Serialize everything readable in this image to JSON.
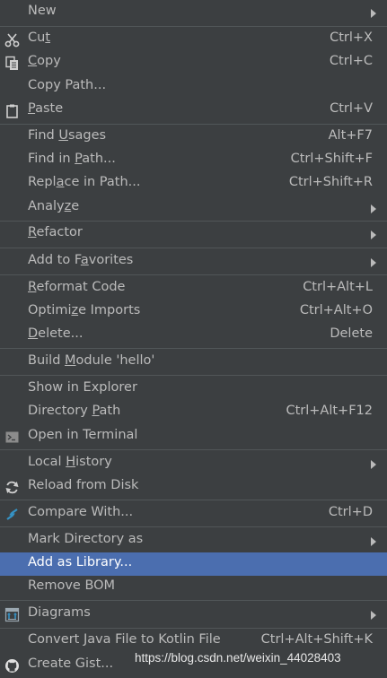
{
  "menu": {
    "items": [
      {
        "pre": "New",
        "u": "",
        "post": "",
        "shortcut": ""
      },
      {
        "pre": "Cu",
        "u": "t",
        "post": "",
        "shortcut": "Ctrl+X"
      },
      {
        "pre": "",
        "u": "C",
        "post": "opy",
        "shortcut": "Ctrl+C"
      },
      {
        "pre": "Copy Path...",
        "u": "",
        "post": "",
        "shortcut": ""
      },
      {
        "pre": "",
        "u": "P",
        "post": "aste",
        "shortcut": "Ctrl+V"
      },
      {
        "pre": "Find ",
        "u": "U",
        "post": "sages",
        "shortcut": "Alt+F7"
      },
      {
        "pre": "Find in ",
        "u": "P",
        "post": "ath...",
        "shortcut": "Ctrl+Shift+F"
      },
      {
        "pre": "Repl",
        "u": "a",
        "post": "ce in Path...",
        "shortcut": "Ctrl+Shift+R"
      },
      {
        "pre": "Analy",
        "u": "z",
        "post": "e",
        "shortcut": ""
      },
      {
        "pre": "",
        "u": "R",
        "post": "efactor",
        "shortcut": ""
      },
      {
        "pre": "Add to F",
        "u": "a",
        "post": "vorites",
        "shortcut": ""
      },
      {
        "pre": "",
        "u": "R",
        "post": "eformat Code",
        "shortcut": "Ctrl+Alt+L"
      },
      {
        "pre": "Optimi",
        "u": "z",
        "post": "e Imports",
        "shortcut": "Ctrl+Alt+O"
      },
      {
        "pre": "",
        "u": "D",
        "post": "elete...",
        "shortcut": "Delete"
      },
      {
        "pre": "Build ",
        "u": "M",
        "post": "odule 'hello'",
        "shortcut": ""
      },
      {
        "pre": "Show in Explorer",
        "u": "",
        "post": "",
        "shortcut": ""
      },
      {
        "pre": "Directory ",
        "u": "P",
        "post": "ath",
        "shortcut": "Ctrl+Alt+F12"
      },
      {
        "pre": "Open in Terminal",
        "u": "",
        "post": "",
        "shortcut": ""
      },
      {
        "pre": "Local ",
        "u": "H",
        "post": "istory",
        "shortcut": ""
      },
      {
        "pre": "Reload from Disk",
        "u": "",
        "post": "",
        "shortcut": ""
      },
      {
        "pre": "Compare With...",
        "u": "",
        "post": "",
        "shortcut": "Ctrl+D"
      },
      {
        "pre": "Mark Directory as",
        "u": "",
        "post": "",
        "shortcut": ""
      },
      {
        "pre": "Add as Library...",
        "u": "",
        "post": "",
        "shortcut": ""
      },
      {
        "pre": "Remove BOM",
        "u": "",
        "post": "",
        "shortcut": ""
      },
      {
        "pre": "Diagrams",
        "u": "",
        "post": "",
        "shortcut": ""
      },
      {
        "pre": "Convert Java File to Kotlin File",
        "u": "",
        "post": "",
        "shortcut": "Ctrl+Alt+Shift+K"
      },
      {
        "pre": "Create Gist...",
        "u": "",
        "post": "",
        "shortcut": ""
      }
    ],
    "icons": {
      "cut": "scissors-icon",
      "copy": "copy-icon",
      "paste": "clipboard-icon",
      "terminal": "terminal-icon",
      "reload": "reload-icon",
      "compare": "compare-icon",
      "diagrams": "diagram-icon",
      "github": "github-icon"
    },
    "colors": {
      "background": "#3c3f41",
      "selected": "#4b6eaf",
      "separator": "#515658",
      "text": "#bbbbbb"
    }
  },
  "watermark": "https://blog.csdn.net/weixin_44028403"
}
